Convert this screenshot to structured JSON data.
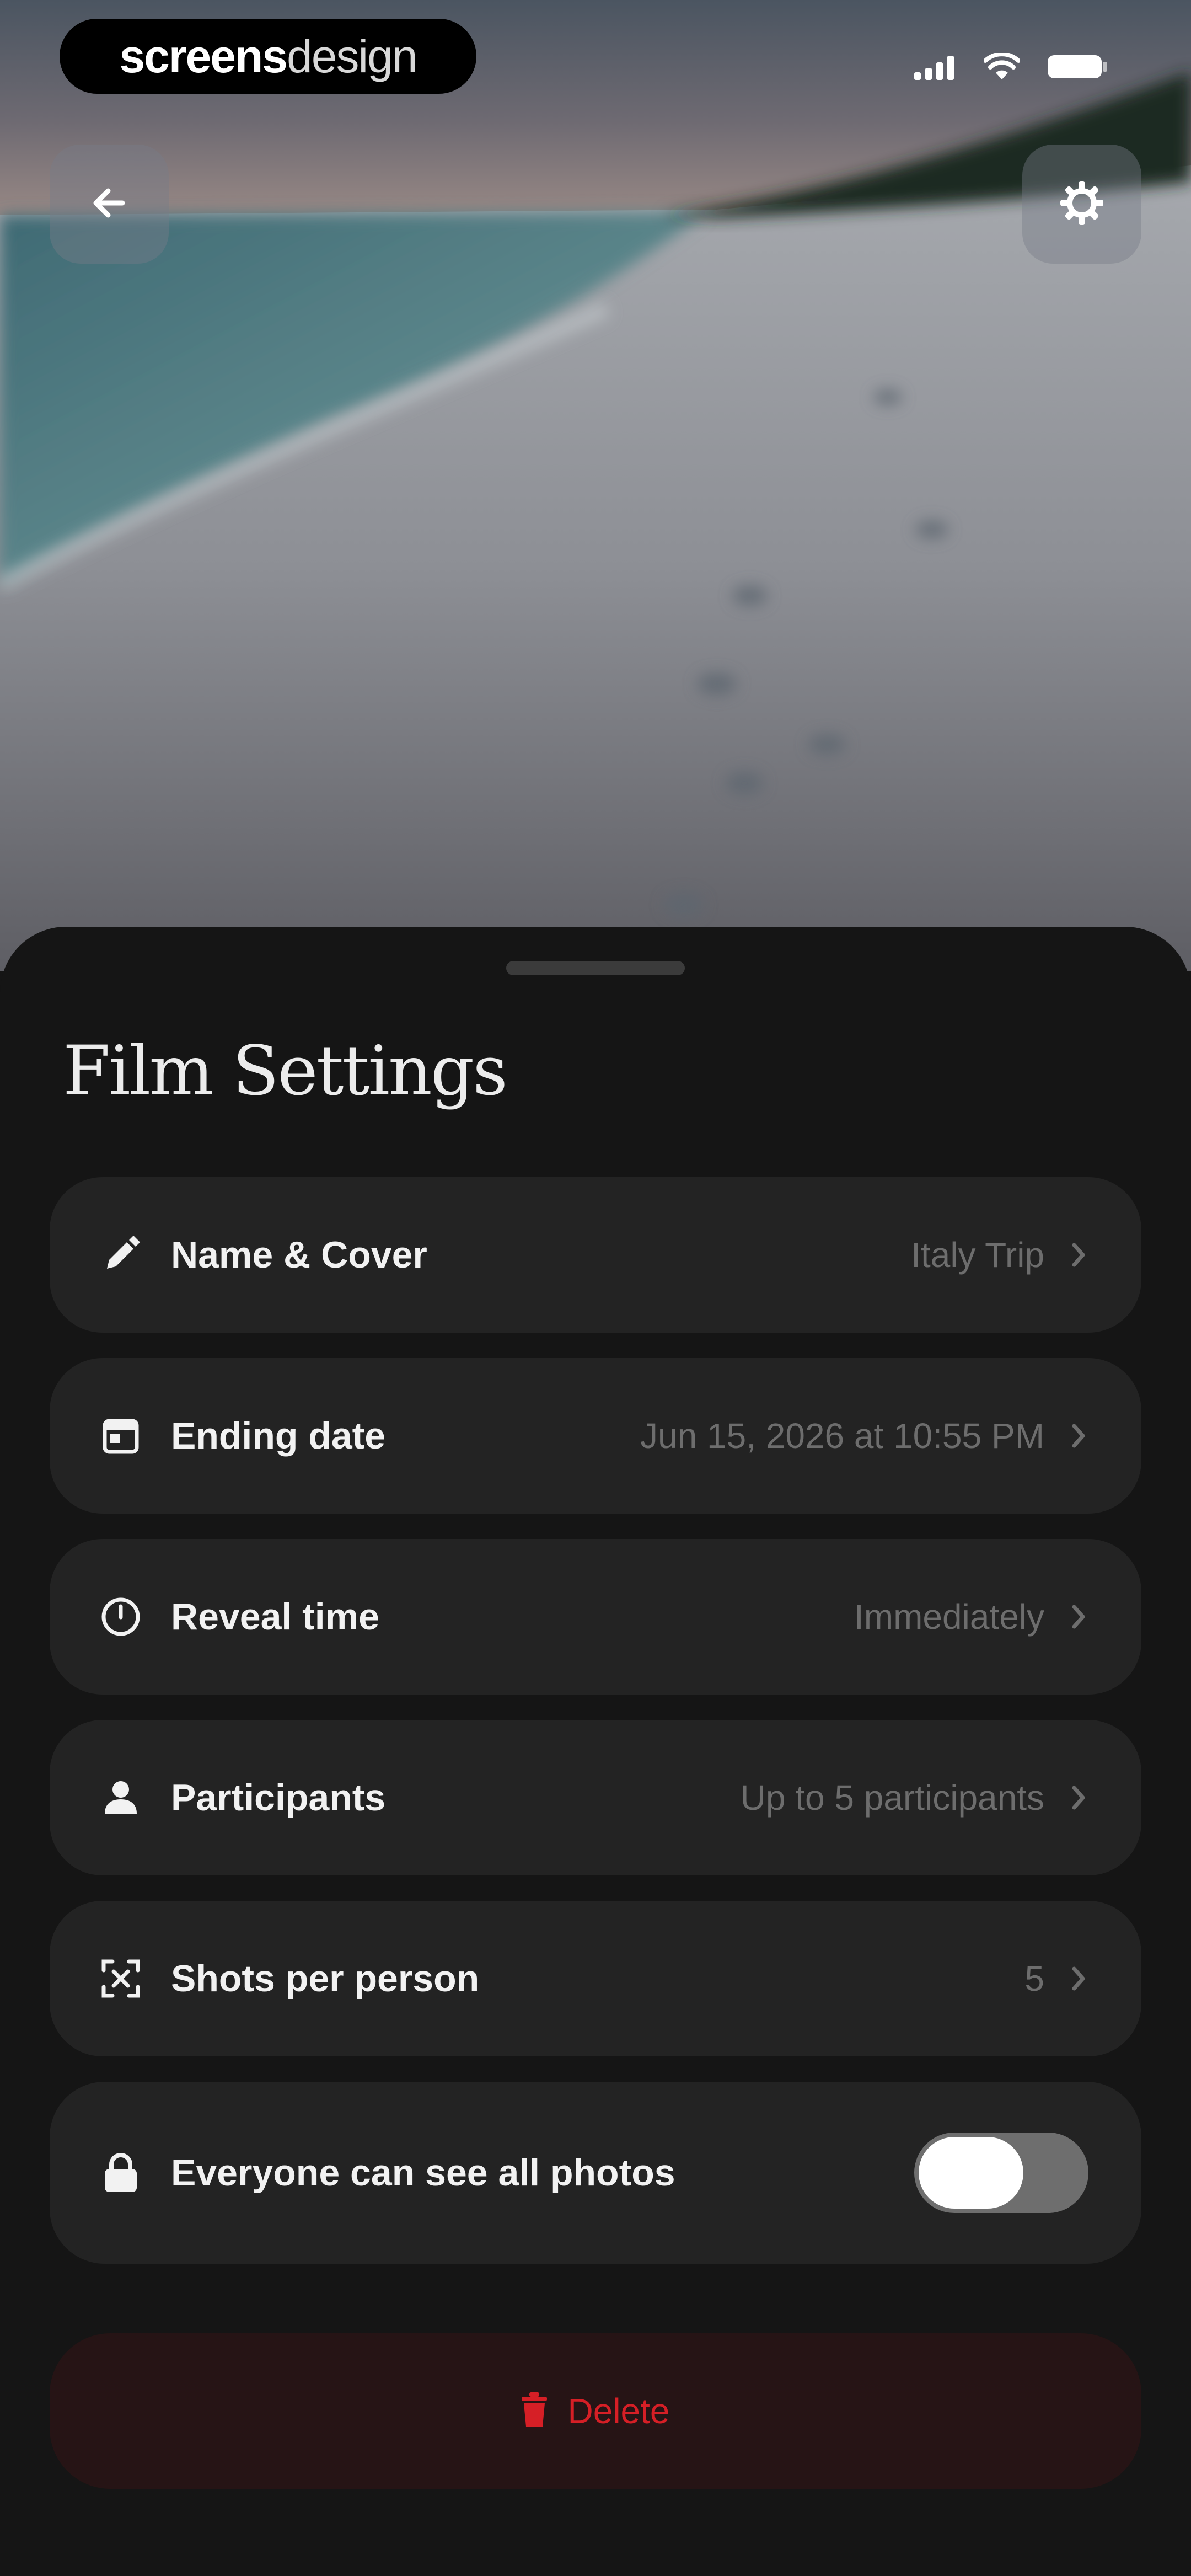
{
  "status_bar": {
    "brand_strong": "screens",
    "brand_light": "design"
  },
  "top_bar": {
    "back_icon": "arrow-left-icon",
    "settings_icon": "gear-icon"
  },
  "sheet": {
    "title": "Film Settings",
    "rows": [
      {
        "icon": "pencil-icon",
        "label": "Name & Cover",
        "value": "Italy Trip"
      },
      {
        "icon": "calendar-icon",
        "label": "Ending date",
        "value": "Jun 15, 2026 at 10:55 PM"
      },
      {
        "icon": "clock-icon",
        "label": "Reveal time",
        "value": "Immediately"
      },
      {
        "icon": "person-icon",
        "label": "Participants",
        "value": "Up to 5 participants"
      },
      {
        "icon": "focus-frame-icon",
        "label": "Shots per person",
        "value": "5"
      }
    ],
    "toggle_row": {
      "icon": "lock-icon",
      "label": "Everyone can see all photos",
      "enabled": true
    },
    "delete": {
      "icon": "trash-icon",
      "label": "Delete"
    }
  },
  "colors": {
    "sheet_background": "#151515",
    "row_background": "#232323",
    "delete_background": "#261415",
    "delete_text": "#d61f26"
  }
}
